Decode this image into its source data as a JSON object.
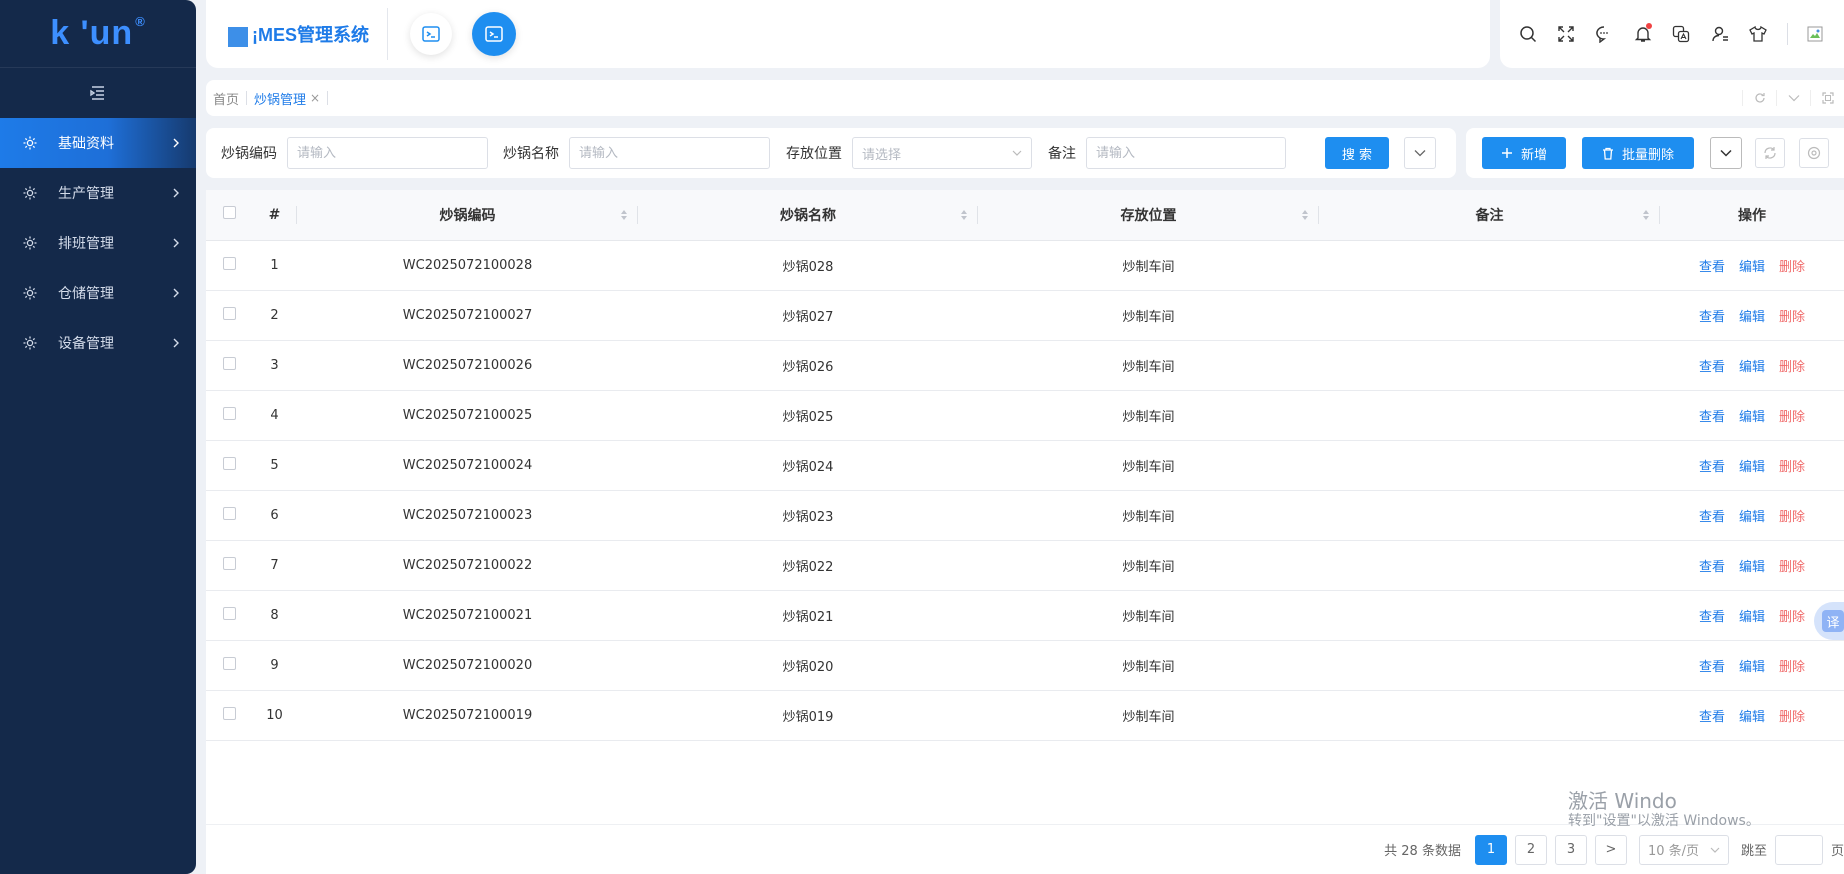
{
  "app": {
    "logo_text": "k  'un",
    "logo_reg": "®",
    "title": "¡MES管理系统"
  },
  "sidebar": {
    "items": [
      {
        "label": "基础资料",
        "active": true
      },
      {
        "label": "生产管理",
        "active": false
      },
      {
        "label": "排班管理",
        "active": false
      },
      {
        "label": "仓储管理",
        "active": false
      },
      {
        "label": "设备管理",
        "active": false
      }
    ]
  },
  "tabs": {
    "home": "首页",
    "active": "炒锅管理",
    "close": "×"
  },
  "filter": {
    "code_label": "炒锅编码",
    "code_placeholder": "请输入",
    "name_label": "炒锅名称",
    "name_placeholder": "请输入",
    "location_label": "存放位置",
    "location_placeholder": "请选择",
    "remark_label": "备注",
    "remark_placeholder": "请输入",
    "search_label": "搜 索"
  },
  "actions": {
    "add_label": "新增",
    "batch_delete_label": "批量删除"
  },
  "table": {
    "columns": [
      "#",
      "炒锅编码",
      "炒锅名称",
      "存放位置",
      "备注",
      "操作"
    ],
    "op_view": "查看",
    "op_edit": "编辑",
    "op_delete": "删除",
    "rows": [
      {
        "idx": "1",
        "code": "WC2025072100028",
        "name": "炒锅028",
        "location": "炒制车间",
        "remark": ""
      },
      {
        "idx": "2",
        "code": "WC2025072100027",
        "name": "炒锅027",
        "location": "炒制车间",
        "remark": ""
      },
      {
        "idx": "3",
        "code": "WC2025072100026",
        "name": "炒锅026",
        "location": "炒制车间",
        "remark": ""
      },
      {
        "idx": "4",
        "code": "WC2025072100025",
        "name": "炒锅025",
        "location": "炒制车间",
        "remark": ""
      },
      {
        "idx": "5",
        "code": "WC2025072100024",
        "name": "炒锅024",
        "location": "炒制车间",
        "remark": ""
      },
      {
        "idx": "6",
        "code": "WC2025072100023",
        "name": "炒锅023",
        "location": "炒制车间",
        "remark": ""
      },
      {
        "idx": "7",
        "code": "WC2025072100022",
        "name": "炒锅022",
        "location": "炒制车间",
        "remark": ""
      },
      {
        "idx": "8",
        "code": "WC2025072100021",
        "name": "炒锅021",
        "location": "炒制车间",
        "remark": ""
      },
      {
        "idx": "9",
        "code": "WC2025072100020",
        "name": "炒锅020",
        "location": "炒制车间",
        "remark": ""
      },
      {
        "idx": "10",
        "code": "WC2025072100019",
        "name": "炒锅019",
        "location": "炒制车间",
        "remark": ""
      }
    ]
  },
  "pagination": {
    "total_text": "共 28 条数据",
    "pages": [
      "1",
      "2",
      "3"
    ],
    "current": "1",
    "next": ">",
    "page_size": "10 条/页",
    "jump_label": "跳至",
    "page_suffix": "页"
  },
  "watermark": {
    "line1": "激活 Windo",
    "line2": "转到\"设置\"以激活 Windows。"
  },
  "translate_fab": "译",
  "colors": {
    "sidebar_bg": "#14294a",
    "primary": "#1e8ef0",
    "link": "#1e7be8",
    "danger": "#f06a6a"
  }
}
